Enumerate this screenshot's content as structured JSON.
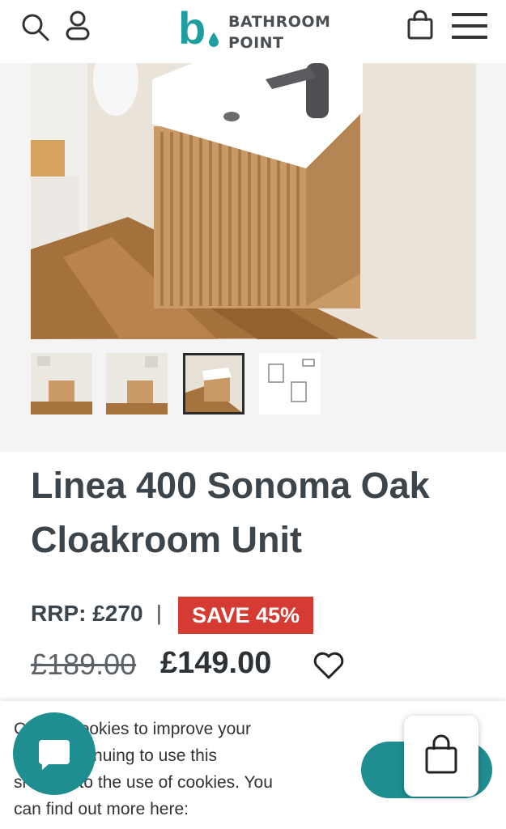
{
  "header": {
    "brand_line1": "BATHROOM",
    "brand_line2": "POINT",
    "brand_letter": "b",
    "brand_color": "#1f9ea2",
    "icons": [
      "search-icon",
      "account-icon",
      "cart-icon",
      "menu-icon"
    ]
  },
  "gallery": {
    "thumbnails": [
      "thumbnail-1",
      "thumbnail-2",
      "thumbnail-3",
      "thumbnail-4"
    ],
    "selected_index": 2
  },
  "product": {
    "title": "Linea 400 Sonoma Oak Cloakroom Unit",
    "rrp": "RRP: £270",
    "separator": "|",
    "save_badge": "SAVE 45%",
    "old_price": "£189.00",
    "price": "£149.00",
    "badge_color": "#d63b33"
  },
  "cookie_banner": {
    "text": "C          uses cookies to improve your\n           e. By continuing to use this\nsi          agree to the use of cookies. You\ncan find out more here:",
    "accent_color": "#1f8e91"
  },
  "floating": {
    "chat_icon": "chat-icon",
    "cart_icon": "cart-icon"
  }
}
